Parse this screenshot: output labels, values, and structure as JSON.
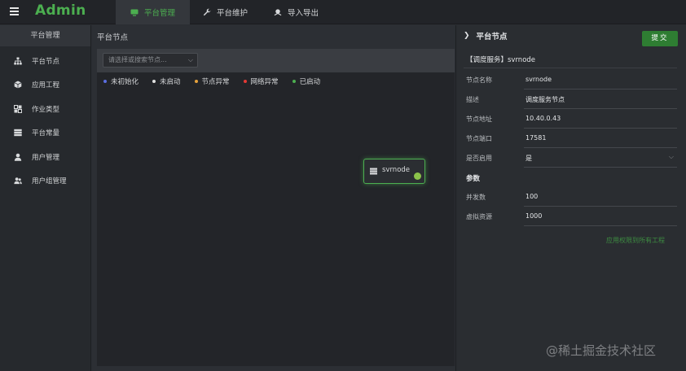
{
  "app": {
    "title": "Admin"
  },
  "topnav": {
    "items": [
      {
        "label": "平台管理",
        "icon": "monitor-icon",
        "active": true
      },
      {
        "label": "平台维护",
        "icon": "wrench-icon",
        "active": false
      },
      {
        "label": "导入导出",
        "icon": "transfer-icon",
        "active": false
      }
    ]
  },
  "sidebar": {
    "header": "平台管理",
    "items": [
      {
        "label": "平台节点",
        "icon": "sitemap-icon"
      },
      {
        "label": "应用工程",
        "icon": "cube-icon"
      },
      {
        "label": "作业类型",
        "icon": "grid-icon"
      },
      {
        "label": "平台常量",
        "icon": "server-icon"
      },
      {
        "label": "用户管理",
        "icon": "user-icon"
      },
      {
        "label": "用户组管理",
        "icon": "users-icon"
      }
    ]
  },
  "main": {
    "title": "平台节点",
    "search": {
      "placeholder": "请选择或搜索节点..."
    },
    "legend": [
      {
        "label": "未初始化",
        "color": "#5b6ee1"
      },
      {
        "label": "未启动",
        "color": "#e0e0e0"
      },
      {
        "label": "节点异常",
        "color": "#e6a23c"
      },
      {
        "label": "网络异常",
        "color": "#e53935"
      },
      {
        "label": "已启动",
        "color": "#4caf50"
      }
    ],
    "node": {
      "label": "svrnode",
      "status_color": "#8bc34a"
    }
  },
  "panel": {
    "title": "平台节点",
    "submit_label": "提交",
    "service_title": "【调度服务】svrnode",
    "fields": [
      {
        "label": "节点名称",
        "value": "svrnode"
      },
      {
        "label": "描述",
        "value": "调度服务节点"
      },
      {
        "label": "节点地址",
        "value": "10.40.0.43"
      },
      {
        "label": "节点端口",
        "value": "17581"
      },
      {
        "label": "是否启用",
        "value": "是"
      }
    ],
    "params_title": "参数",
    "params": [
      {
        "label": "并发数",
        "value": "100"
      },
      {
        "label": "虚拟资源",
        "value": "1000"
      }
    ],
    "apply_label": "应用权限到所有工程"
  },
  "watermark": "@稀土掘金技术社区",
  "colors": {
    "accent": "#4caf50",
    "background": "#2b2e33",
    "submit": "#2e7d32"
  }
}
